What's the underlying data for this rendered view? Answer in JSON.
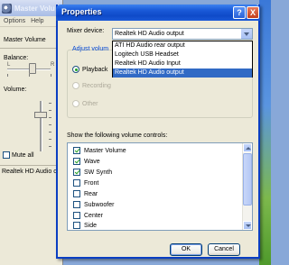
{
  "background_window": {
    "title": "Master Volu",
    "menu": [
      "Options",
      "Help"
    ],
    "device_name": "Master Volume",
    "balance_label": "Balance:",
    "balance_left": "L",
    "balance_right": "R",
    "volume_label": "Volume:",
    "mute_label": "Mute all",
    "status": "Realtek HD Audio out"
  },
  "dialog": {
    "title": "Properties",
    "help_glyph": "?",
    "close_glyph": "X",
    "mixer_device_label": "Mixer device:",
    "mixer_device_value": "Realtek HD Audio output",
    "dropdown_options": [
      "ATI HD Audio rear output",
      "Logitech USB Headset",
      "Realtek HD Audio Input",
      "Realtek HD Audio output"
    ],
    "adjust_volume_label": "Adjust volum",
    "radio_playback": "Playback",
    "radio_recording": "Recording",
    "radio_other": "Other",
    "show_controls_label": "Show the following volume controls:",
    "controls": [
      {
        "label": "Master Volume",
        "checked": true
      },
      {
        "label": "Wave",
        "checked": true
      },
      {
        "label": "SW Synth",
        "checked": true
      },
      {
        "label": "Front",
        "checked": false
      },
      {
        "label": "Rear",
        "checked": false
      },
      {
        "label": "Subwoofer",
        "checked": false
      },
      {
        "label": "Center",
        "checked": false
      },
      {
        "label": "Side",
        "checked": false
      }
    ],
    "ok_label": "OK",
    "cancel_label": "Cancel"
  }
}
